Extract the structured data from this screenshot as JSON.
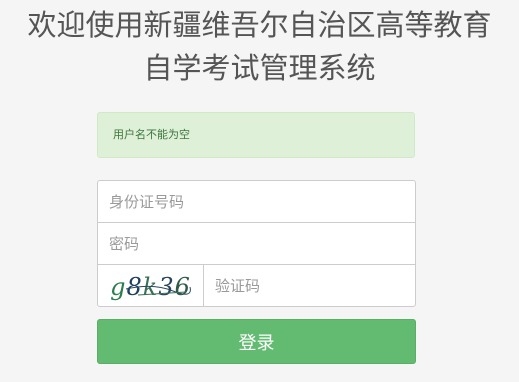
{
  "header": {
    "title_line1": "欢迎使用新疆维吾尔自治区高等教育",
    "title_line2": "自学考试管理系统"
  },
  "alert": {
    "message": "用户名不能为空"
  },
  "form": {
    "id_field": {
      "placeholder": "身份证号码",
      "value": ""
    },
    "password_field": {
      "placeholder": "密码",
      "value": ""
    },
    "captcha": {
      "image_text": "g8k36",
      "input_placeholder": "验证码",
      "input_value": ""
    },
    "login_label": "登录"
  },
  "colors": {
    "background": "#f5f5f5",
    "alert_background": "#dff0d8",
    "alert_text": "#3c763d",
    "button": "#63bb72",
    "title_text": "#555555"
  }
}
